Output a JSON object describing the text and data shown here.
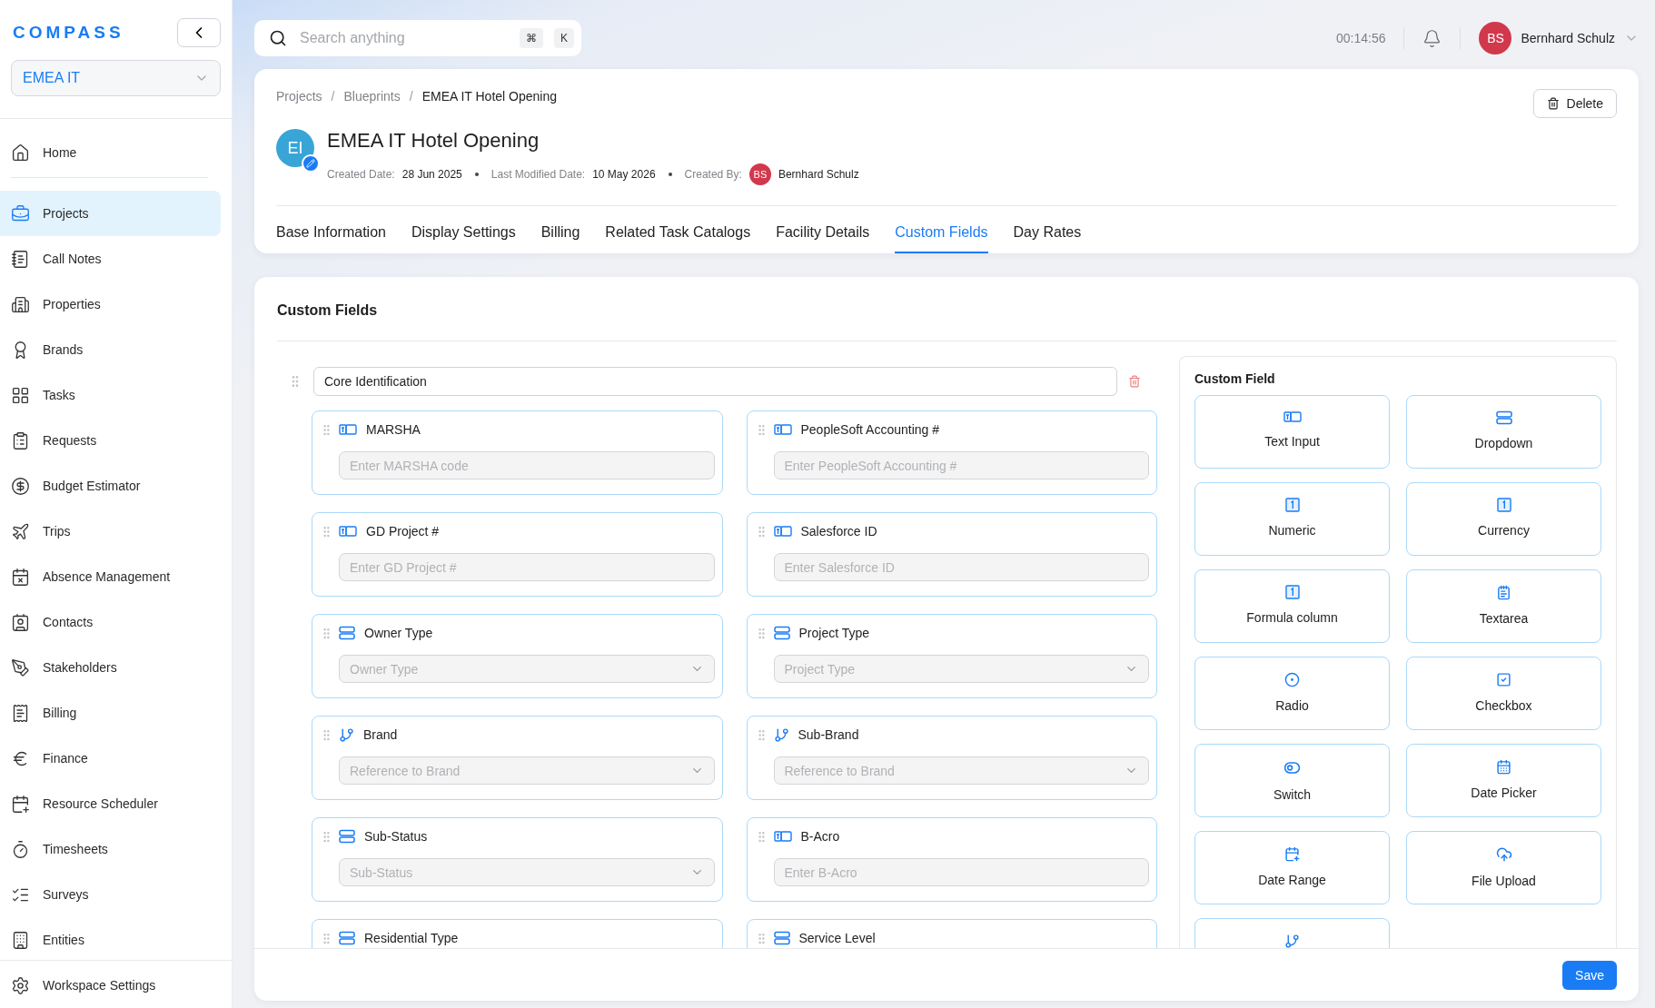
{
  "sidebar": {
    "logo": "COMPASS",
    "workspace": "EMEA IT",
    "items": [
      {
        "label": "Home",
        "selected": false
      },
      {
        "label": "Projects",
        "selected": true
      },
      {
        "label": "Call Notes",
        "selected": false
      },
      {
        "label": "Properties",
        "selected": false
      },
      {
        "label": "Brands",
        "selected": false
      },
      {
        "label": "Tasks",
        "selected": false
      },
      {
        "label": "Requests",
        "selected": false
      },
      {
        "label": "Budget Estimator",
        "selected": false
      },
      {
        "label": "Trips",
        "selected": false
      },
      {
        "label": "Absence Management",
        "selected": false
      },
      {
        "label": "Contacts",
        "selected": false
      },
      {
        "label": "Stakeholders",
        "selected": false
      },
      {
        "label": "Billing",
        "selected": false
      },
      {
        "label": "Finance",
        "selected": false
      },
      {
        "label": "Resource Scheduler",
        "selected": false
      },
      {
        "label": "Timesheets",
        "selected": false
      },
      {
        "label": "Surveys",
        "selected": false
      },
      {
        "label": "Entities",
        "selected": false
      }
    ],
    "footer_item": {
      "label": "Workspace Settings",
      "selected": false
    }
  },
  "topbar": {
    "search_placeholder": "Search anything",
    "shortcut_keys": [
      "⌘",
      "K"
    ],
    "timer": "00:14:56",
    "user": {
      "initials": "BS",
      "name": "Bernhard Schulz"
    }
  },
  "header": {
    "breadcrumb_separator": "/",
    "breadcrumbs": [
      "Projects",
      "Blueprints",
      "EMEA IT Hotel Opening"
    ],
    "avatar": "EI",
    "title": "EMEA IT Hotel Opening",
    "delete_label": "Delete",
    "meta": [
      {
        "label": "Created Date:",
        "value": "28 Jun 2025"
      },
      {
        "label": "Last Modified Date:",
        "value": "10 May 2026"
      },
      {
        "label": "Created By:",
        "value": "Bernhard Schulz",
        "initials": "BS"
      }
    ],
    "tabs": [
      {
        "label": "Base Information",
        "selected": false
      },
      {
        "label": "Display Settings",
        "selected": false
      },
      {
        "label": "Billing",
        "selected": false
      },
      {
        "label": "Related Task Catalogs",
        "selected": false
      },
      {
        "label": "Facility Details",
        "selected": false
      },
      {
        "label": "Custom Fields",
        "selected": true
      },
      {
        "label": "Day Rates",
        "selected": false
      }
    ]
  },
  "custom_fields": {
    "title": "Custom Fields",
    "section_name": "Core Identification",
    "fields": [
      {
        "label": "MARSHA",
        "kind": "text",
        "placeholder": "Enter MARSHA code"
      },
      {
        "label": "PeopleSoft Accounting #",
        "kind": "text",
        "placeholder": "Enter PeopleSoft Accounting #"
      },
      {
        "label": "GD Project #",
        "kind": "text",
        "placeholder": "Enter GD Project #"
      },
      {
        "label": "Salesforce ID",
        "kind": "text",
        "placeholder": "Enter Salesforce ID"
      },
      {
        "label": "Owner Type",
        "kind": "dropdown",
        "placeholder": "Owner Type"
      },
      {
        "label": "Project Type",
        "kind": "dropdown",
        "placeholder": "Project Type"
      },
      {
        "label": "Brand",
        "kind": "reference",
        "placeholder": "Reference to Brand"
      },
      {
        "label": "Sub-Brand",
        "kind": "reference",
        "placeholder": "Reference to Brand"
      },
      {
        "label": "Sub-Status",
        "kind": "dropdown",
        "placeholder": "Sub-Status"
      },
      {
        "label": "B-Acro",
        "kind": "text",
        "placeholder": "Enter B-Acro"
      },
      {
        "label": "Residential Type",
        "kind": "dropdown"
      },
      {
        "label": "Service Level",
        "kind": "dropdown"
      }
    ],
    "palette": {
      "title": "Custom Field",
      "items": [
        {
          "label": "Text Input",
          "kind": "text"
        },
        {
          "label": "Dropdown",
          "kind": "dropdown"
        },
        {
          "label": "Numeric",
          "kind": "numeric"
        },
        {
          "label": "Currency",
          "kind": "numeric"
        },
        {
          "label": "Formula column",
          "kind": "numeric"
        },
        {
          "label": "Textarea",
          "kind": "textarea"
        },
        {
          "label": "Radio",
          "kind": "radio"
        },
        {
          "label": "Checkbox",
          "kind": "checkbox"
        },
        {
          "label": "Switch",
          "kind": "switch"
        },
        {
          "label": "Date Picker",
          "kind": "date"
        },
        {
          "label": "Date Range",
          "kind": "date-range"
        },
        {
          "label": "File Upload",
          "kind": "upload"
        },
        {
          "kind": "reference"
        }
      ]
    },
    "save_label": "Save"
  }
}
